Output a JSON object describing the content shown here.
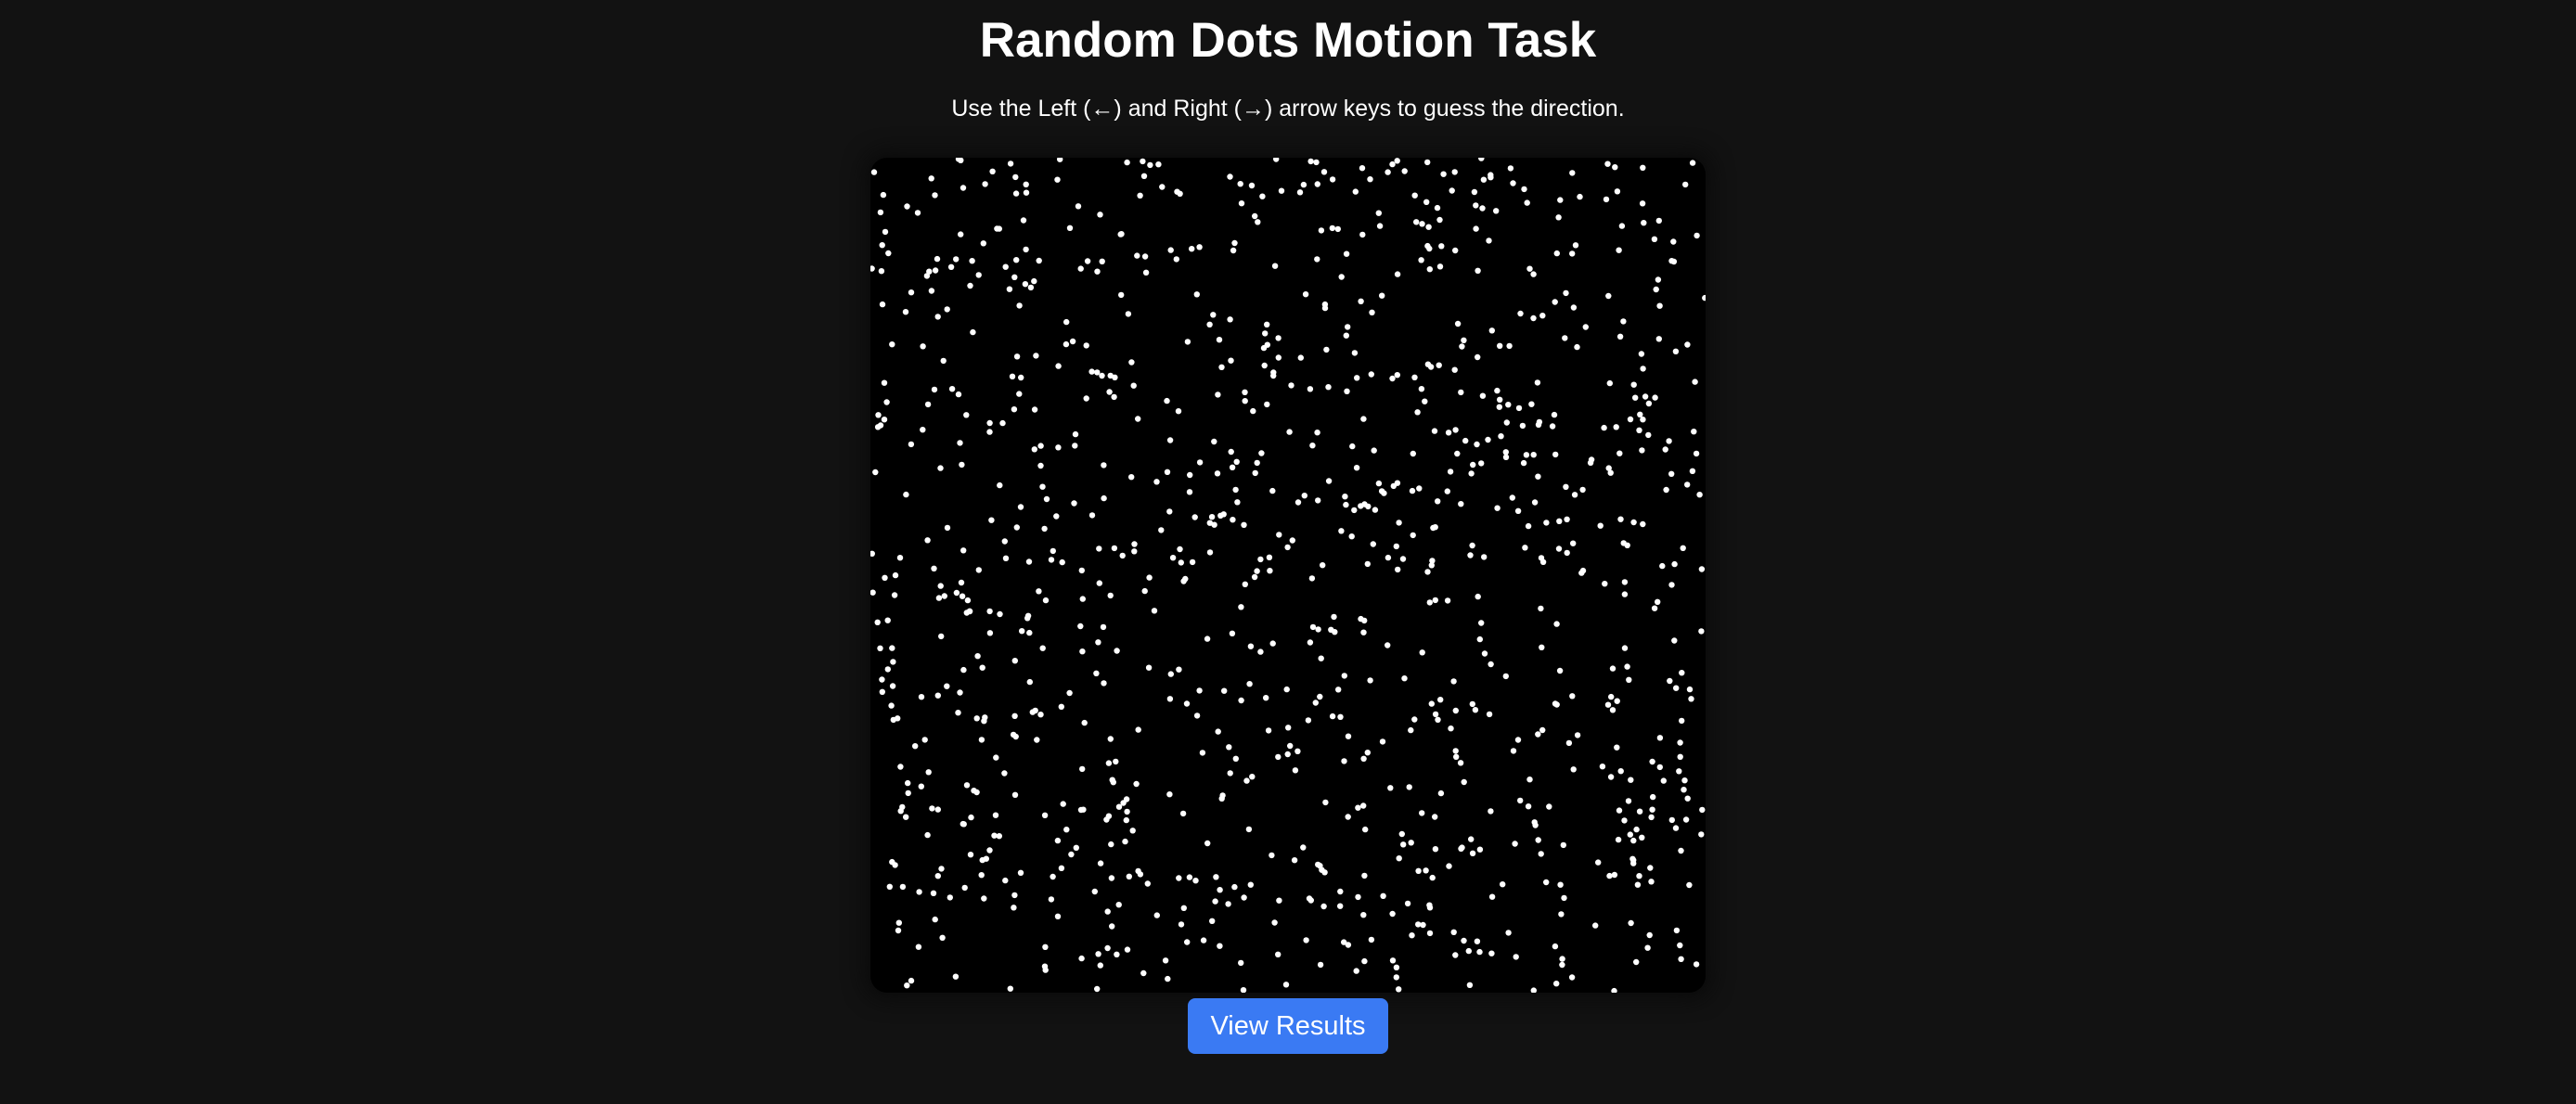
{
  "header": {
    "title": "Random Dots Motion Task",
    "instructions": "Use the Left (←) and Right (→) arrow keys to guess the direction."
  },
  "stimulus": {
    "background_color": "#000000",
    "dot_color": "#ffffff"
  },
  "actions": {
    "view_results_label": "View Results",
    "button_color": "#3a7af3"
  }
}
